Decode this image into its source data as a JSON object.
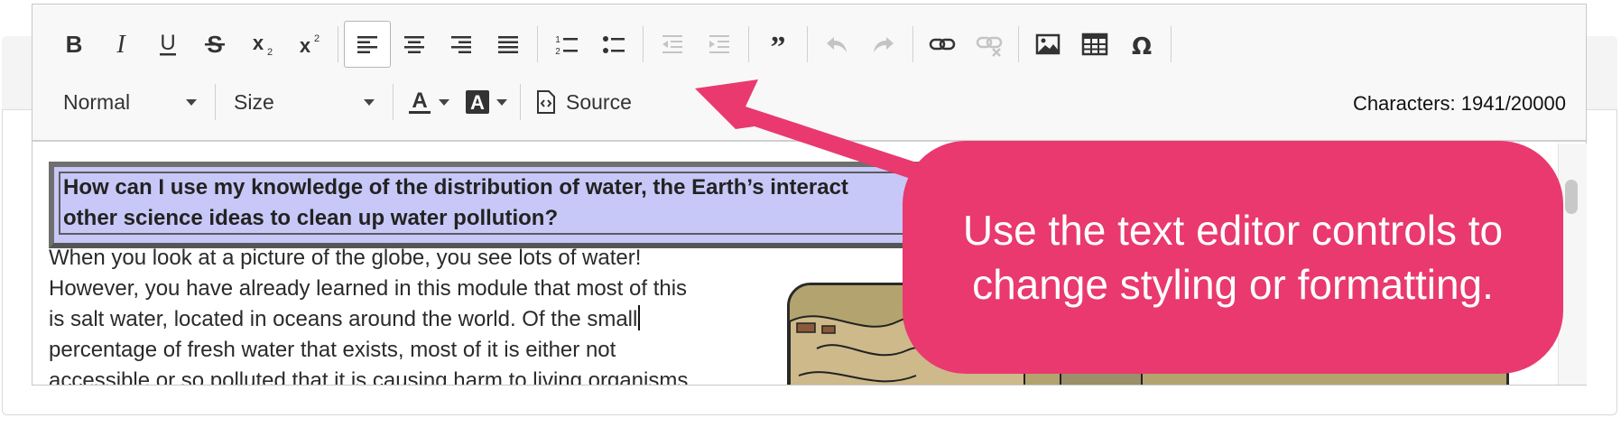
{
  "toolbar": {
    "row1": [
      {
        "name": "bold",
        "icon": "bold-icon"
      },
      {
        "name": "italic",
        "icon": "italic-icon"
      },
      {
        "name": "underline",
        "icon": "underline-icon"
      },
      {
        "name": "strikethrough",
        "icon": "strikethrough-icon"
      },
      {
        "name": "subscript",
        "icon": "subscript-icon"
      },
      {
        "name": "superscript",
        "icon": "superscript-icon"
      },
      {
        "name": "align-left",
        "icon": "align-left-icon",
        "active": true
      },
      {
        "name": "align-center",
        "icon": "align-center-icon"
      },
      {
        "name": "align-right",
        "icon": "align-right-icon"
      },
      {
        "name": "justify",
        "icon": "justify-icon"
      },
      {
        "name": "numbered-list",
        "icon": "numbered-list-icon"
      },
      {
        "name": "bulleted-list",
        "icon": "bulleted-list-icon"
      },
      {
        "name": "decrease-indent",
        "icon": "decrease-indent-icon",
        "disabled": true
      },
      {
        "name": "increase-indent",
        "icon": "increase-indent-icon",
        "disabled": true
      },
      {
        "name": "blockquote",
        "icon": "blockquote-icon"
      },
      {
        "name": "undo",
        "icon": "undo-icon",
        "disabled": true
      },
      {
        "name": "redo",
        "icon": "redo-icon",
        "disabled": true
      },
      {
        "name": "link",
        "icon": "link-icon"
      },
      {
        "name": "unlink",
        "icon": "unlink-icon",
        "disabled": true
      },
      {
        "name": "image",
        "icon": "image-icon"
      },
      {
        "name": "table",
        "icon": "table-icon"
      },
      {
        "name": "special-char",
        "icon": "omega-icon"
      }
    ],
    "format_value": "Normal",
    "size_value": "Size",
    "text_color_icon": "text-color-icon",
    "bg_color_icon": "background-color-icon",
    "source_label": "Source",
    "source_icon": "source-icon",
    "char_count": "Characters: 1941/20000"
  },
  "content": {
    "question_line1": "How can I use my knowledge of the distribution of water, the Earth’s interact",
    "question_line2": "other science ideas to clean up water pollution?",
    "body_lines": [
      "When you look at a picture of the globe, you see lots of water!",
      "However, you have already learned in this module that most of this",
      "is salt water, located in oceans around the world. Of the small",
      "percentage of fresh water that exists, most of it is either not",
      "accessible or so polluted that it is causing harm to living organisms"
    ]
  },
  "callout": {
    "text": "Use the text editor controls to change styling or formatting."
  },
  "colors": {
    "callout": "#e9396f",
    "question_bg": "#c7c8f7",
    "toolbar_bg": "#f8f8f8"
  }
}
